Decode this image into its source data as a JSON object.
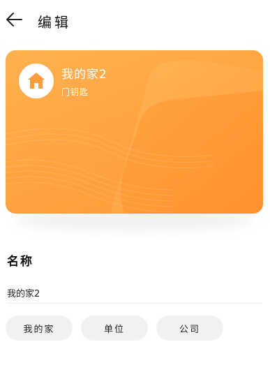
{
  "header": {
    "title": "编辑",
    "back_icon": "arrow-left-icon"
  },
  "card": {
    "name": "我的家2",
    "subtitle": "门钥匙",
    "icon": "home-icon",
    "colors": {
      "gradient_start": "#ffb24f",
      "gradient_end": "#ff9a3a",
      "text": "#ffffff"
    }
  },
  "name_section": {
    "label": "名称",
    "input_value": "我的家2",
    "suggestions": [
      "我的家",
      "单位",
      "公司"
    ]
  }
}
